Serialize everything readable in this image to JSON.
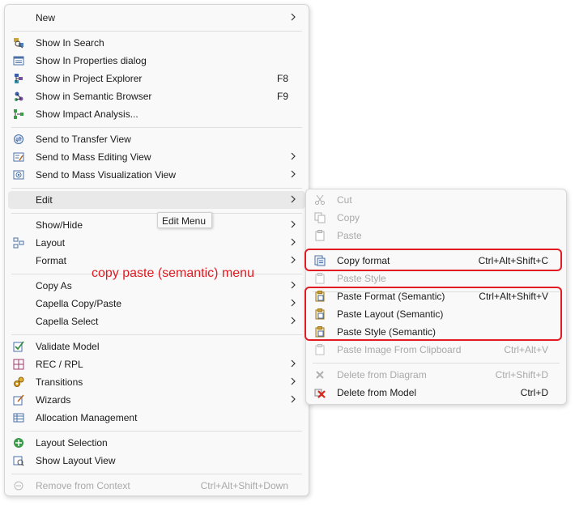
{
  "main_menu": {
    "new_label": "New",
    "show_in_search": "Show In Search",
    "show_in_properties": "Show In Properties dialog",
    "show_in_project_explorer": "Show in Project Explorer",
    "show_in_project_explorer_shortcut": "F8",
    "show_in_semantic_browser": "Show in Semantic Browser",
    "show_in_semantic_browser_shortcut": "F9",
    "show_impact_analysis": "Show Impact Analysis...",
    "send_to_transfer_view": "Send to Transfer View",
    "send_to_mass_editing_view": "Send to Mass Editing View",
    "send_to_mass_visualization_view": "Send to Mass Visualization View",
    "edit": "Edit",
    "show_hide": "Show/Hide",
    "layout": "Layout",
    "format": "Format",
    "copy_as": "Copy As",
    "capella_copy_paste": "Capella Copy/Paste",
    "capella_select": "Capella Select",
    "validate_model": "Validate Model",
    "rec_rpl": "REC / RPL",
    "transitions": "Transitions",
    "wizards": "Wizards",
    "allocation_management": "Allocation Management",
    "layout_selection": "Layout Selection",
    "show_layout_view": "Show Layout View",
    "remove_from_context": "Remove from Context",
    "remove_from_context_shortcut": "Ctrl+Alt+Shift+Down"
  },
  "edit_submenu": {
    "cut": "Cut",
    "copy": "Copy",
    "paste": "Paste",
    "copy_format": "Copy format",
    "copy_format_shortcut": "Ctrl+Alt+Shift+C",
    "paste_style": "Paste Style",
    "paste_format_semantic": "Paste Format (Semantic)",
    "paste_format_semantic_shortcut": "Ctrl+Alt+Shift+V",
    "paste_layout_semantic": "Paste Layout (Semantic)",
    "paste_style_semantic": "Paste Style (Semantic)",
    "paste_image_from_clipboard": "Paste Image From Clipboard",
    "paste_image_from_clipboard_shortcut": "Ctrl+Alt+V",
    "delete_from_diagram": "Delete from Diagram",
    "delete_from_diagram_shortcut": "Ctrl+Shift+D",
    "delete_from_model": "Delete from Model",
    "delete_from_model_shortcut": "Ctrl+D"
  },
  "tooltip": {
    "text": "Edit Menu"
  },
  "annotation": {
    "text": "copy paste (semantic) menu",
    "color": "#e11b22"
  },
  "colors": {
    "menu_bg": "#f9f9f9",
    "highlight": "#e9e9e9",
    "disabled_text": "#a9a9a9",
    "annotation_red": "#e11b22"
  }
}
